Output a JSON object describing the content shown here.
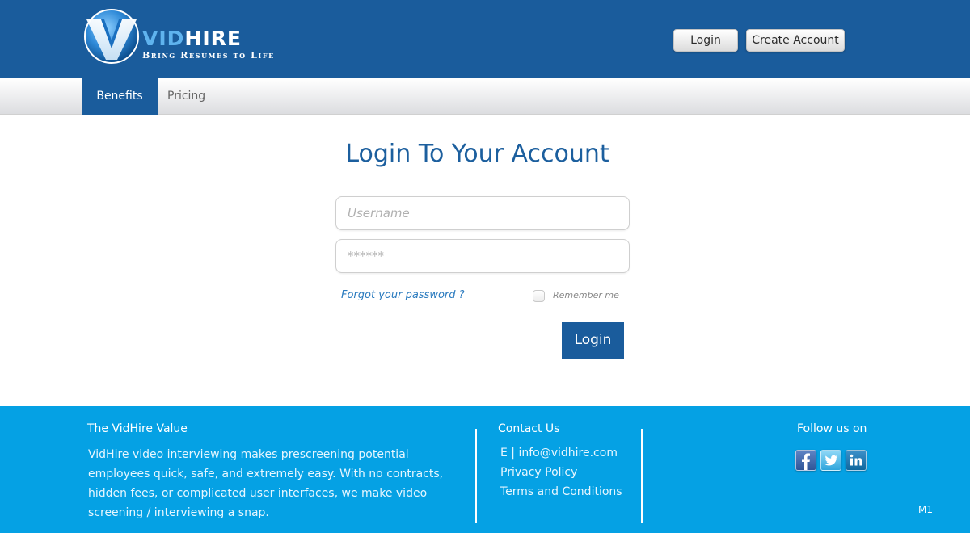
{
  "brand": {
    "name_part1": "VID",
    "name_part2": "HIRE",
    "tagline": "Bring Resumes to Life",
    "colors": {
      "header": "#1a5c9c",
      "footer": "#05a1e4",
      "accent": "#2b7bbf"
    }
  },
  "header": {
    "login_label": "Login",
    "create_account_label": "Create Account"
  },
  "nav": {
    "tabs": [
      {
        "label": "Benefits",
        "active": true
      },
      {
        "label": "Pricing",
        "active": false
      }
    ]
  },
  "login": {
    "title": "Login To Your Account",
    "username_placeholder": "Username",
    "password_placeholder": "******",
    "forgot_label": "Forgot your password ?",
    "remember_label": "Remember me",
    "remember_checked": false,
    "submit_label": "Login"
  },
  "footer": {
    "value_heading": "The VidHire Value",
    "value_text": "VidHire video interviewing makes prescreening potential employees quick, safe, and extremely easy. With no contracts, hidden fees, or complicated user interfaces, we make video screening / interviewing a snap.",
    "contact_heading": "Contact Us",
    "email": "E | info@vidhire.com",
    "privacy": "Privacy Policy",
    "terms": "Terms and Conditions",
    "follow_heading": "Follow us on",
    "social": [
      {
        "name": "facebook",
        "icon": "facebook-icon"
      },
      {
        "name": "twitter",
        "icon": "twitter-icon"
      },
      {
        "name": "linkedin",
        "icon": "linkedin-icon"
      }
    ],
    "page_code": "M1"
  }
}
